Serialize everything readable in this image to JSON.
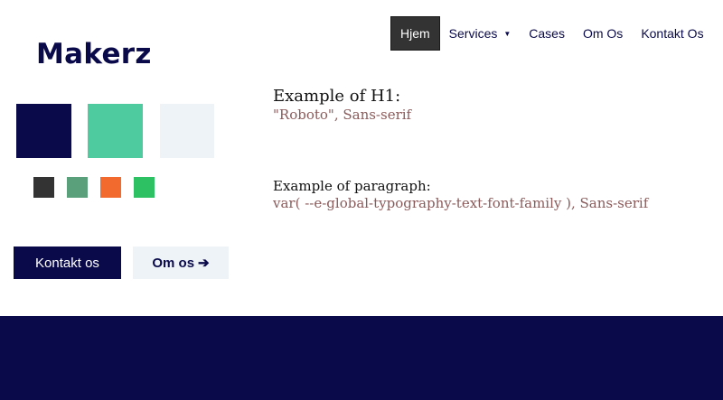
{
  "brand": {
    "logo_text": "Makerz"
  },
  "nav": {
    "items": [
      {
        "label": "Hjem",
        "active": true
      },
      {
        "label": "Services",
        "has_dropdown": true
      },
      {
        "label": "Cases"
      },
      {
        "label": "Om Os"
      },
      {
        "label": "Kontakt Os"
      }
    ],
    "dropdown_icon": "caret-down-icon"
  },
  "palette": {
    "primary": [
      "#0a0a4a",
      "#4ecb9f",
      "#eef3f8"
    ],
    "secondary": [
      "#333333",
      "#5aa07a",
      "#f26a2e",
      "#2dc163"
    ]
  },
  "typography": {
    "h1_label": "Example of H1:",
    "h1_value": "\"Roboto\", Sans-serif",
    "p_label": "Example of paragraph:",
    "p_value": "var( --e-global-typography-text-font-family ), Sans-serif"
  },
  "buttons": {
    "primary_label": "Kontakt os",
    "secondary_label": "Om os",
    "secondary_icon": "arrow-right-icon"
  },
  "colors": {
    "accent": "#0a0a4a",
    "text_value": "#8b5a5a"
  }
}
